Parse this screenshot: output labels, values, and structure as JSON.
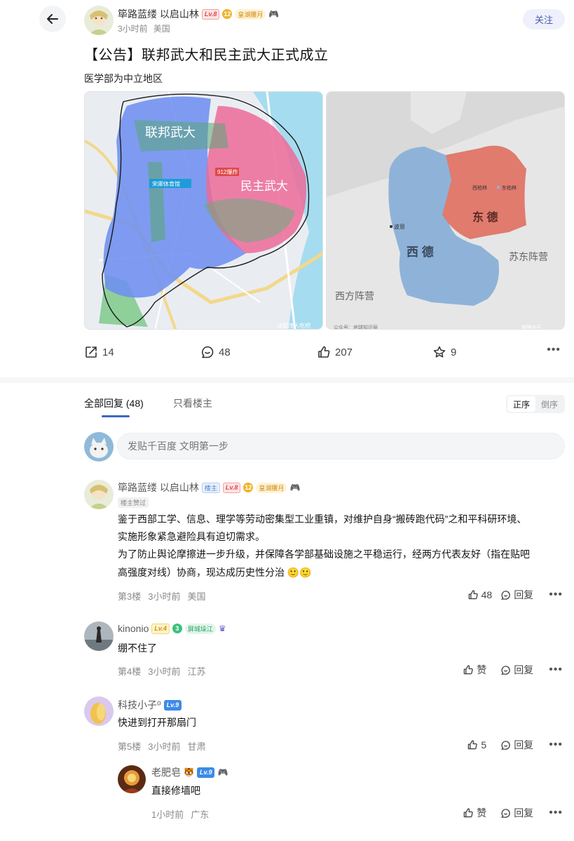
{
  "post": {
    "author": "筚路蓝缕 以启山林",
    "level": "Lv.8",
    "member_badge": "皇湖腰月",
    "time": "3小时前",
    "location": "美国",
    "follow_label": "关注",
    "title": "【公告】联邦武大和民主武大正式成立",
    "body": "医学部为中立地区"
  },
  "map_left": {
    "label_fed": "联邦武大",
    "label_dem": "民主武大",
    "poi_1": "宋卿体育馆",
    "poi_2": "912爆炸",
    "watermark": "@凯茂人吃吧"
  },
  "map_right": {
    "west": "西 德",
    "east": "东 德",
    "west_camp": "西方阵营",
    "east_camp": "苏东阵营",
    "bonn": "波恩",
    "west_berlin": "西柏林",
    "east_berlin": "东柏林",
    "source": "公众号：地球知识局",
    "source_right": "微博@天"
  },
  "actions": {
    "share": "14",
    "comments": "48",
    "likes": "207",
    "stars": "9"
  },
  "tabs": {
    "all": "全部回复 (48)",
    "owner": "只看楼主",
    "sort_asc": "正序",
    "sort_desc": "倒序"
  },
  "reply_input": {
    "placeholder": "发贴千百度 文明第一步"
  },
  "comments": [
    {
      "name": "筚路蓝缕 以启山林",
      "owner_tag": "楼主",
      "level": "Lv.8",
      "badge": "皇湖腰月",
      "liked_tag": "楼主赞过",
      "lines": [
        "鉴于西部工学、信息、理学等劳动密集型工业重镇，对维护自身“搬砖跑代码”之和平科研环境、",
        "实施形象紧急避险具有迫切需求。",
        "为了防止舆论摩擦进一步升级，并保障各学部基础设施之平稳运行，经两方代表友好（指在贴吧",
        "高强度对线）协商，现达成历史性分治 🙂🙂"
      ],
      "floor": "第3楼",
      "time": "3小时前",
      "location": "美国",
      "like_label": "48",
      "reply_label": "回复"
    },
    {
      "name": "kinonio",
      "level": "Lv.4",
      "badge": "屏城垛江",
      "lines": [
        "绷不住了"
      ],
      "floor": "第4楼",
      "time": "3小时前",
      "location": "江苏",
      "like_label": "赞",
      "reply_label": "回复"
    },
    {
      "name": "科技小子⁰",
      "level": "Lv.9",
      "lines": [
        "快进到打开那扇门"
      ],
      "floor": "第5楼",
      "time": "3小时前",
      "location": "甘肃",
      "like_label": "5",
      "reply_label": "回复"
    },
    {
      "name": "老肥皂",
      "level": "Lv.9",
      "lines": [
        "直接修墙吧"
      ],
      "time": "1小时前",
      "location": "广东",
      "like_label": "赞",
      "reply_label": "回复"
    }
  ],
  "colors": {
    "federal_blue": "#6e8ff0",
    "democratic_pink": "#ec6a99",
    "west_germany": "#8fb3d8",
    "east_germany": "#e07b6e",
    "accent_blue": "#3c68c6"
  }
}
